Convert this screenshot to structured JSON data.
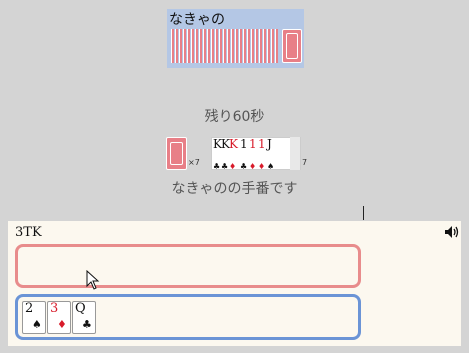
{
  "opponent": {
    "name": "なきゃの",
    "card_back_icon": "card-back-icon"
  },
  "status": {
    "timer": "残り60秒",
    "turn_message": "なきゃのの手番です"
  },
  "deck": {
    "count": "×7"
  },
  "pile": {
    "count": "7",
    "cards": [
      {
        "rank": "K",
        "suit": "♣",
        "color": "black"
      },
      {
        "rank": "K",
        "suit": "♣",
        "color": "black"
      },
      {
        "rank": "K",
        "suit": "♦",
        "color": "red"
      },
      {
        "rank": "1",
        "suit": "♣",
        "color": "black"
      },
      {
        "rank": "1",
        "suit": "♦",
        "color": "red"
      },
      {
        "rank": "1",
        "suit": "♦",
        "color": "red"
      },
      {
        "rank": "J",
        "suit": "♠",
        "color": "black"
      }
    ]
  },
  "player": {
    "name": "3TK",
    "sound_icon": "speaker-icon",
    "hand": [
      {
        "rank": "2",
        "suit": "♠",
        "color": "black"
      },
      {
        "rank": "3",
        "suit": "♦",
        "color": "red"
      },
      {
        "rank": "Q",
        "suit": "♣",
        "color": "black"
      }
    ]
  },
  "colors": {
    "opponent_panel": "#b4c7e5",
    "card_back": "#e87f87",
    "play_zone_border": "#e88c8c",
    "hand_zone_border": "#6b94d6",
    "player_area": "#fcf8ef",
    "background": "#d4d4d4"
  }
}
